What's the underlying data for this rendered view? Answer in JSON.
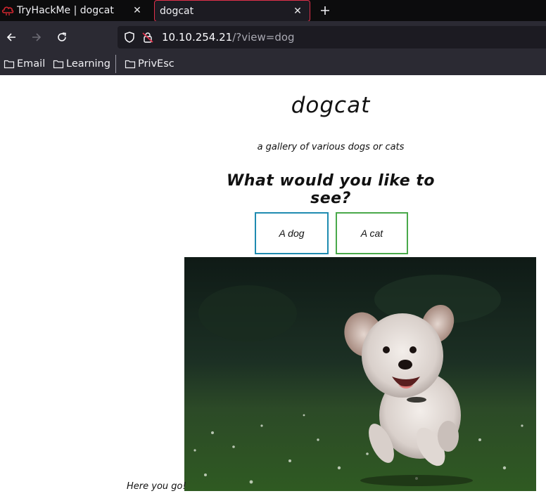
{
  "browser": {
    "tabs": [
      {
        "title": "TryHackMe | dogcat",
        "active": false
      },
      {
        "title": "dogcat",
        "active": true
      }
    ],
    "address": {
      "host": "10.10.254.21",
      "path": "/?view=dog"
    },
    "bookmarks": [
      "Email",
      "Learning",
      "PrivEsc"
    ],
    "colors": {
      "tabbar": "#0c0c0d",
      "toolbar": "#2b2a33",
      "urlbar": "#1c1b22",
      "active_tab_border": "#e0304a"
    }
  },
  "page": {
    "title": "dogcat",
    "subtitle": "a gallery of various dogs or cats",
    "question": "What would you like to see?",
    "buttons": [
      {
        "label": "A dog",
        "border_color": "#1f8bb0"
      },
      {
        "label": "A cat",
        "border_color": "#49a94a"
      }
    ],
    "image_subject": "dog-photo",
    "caption": "Here you go!"
  }
}
